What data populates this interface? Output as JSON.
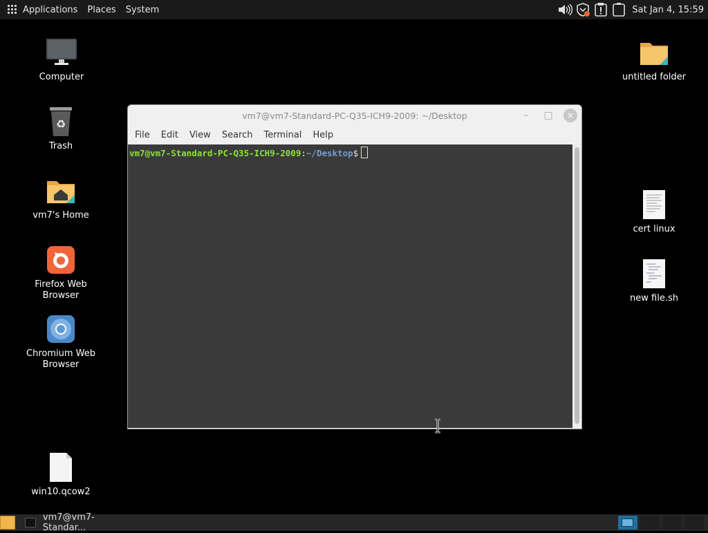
{
  "top_panel": {
    "menus": [
      "Applications",
      "Places",
      "System"
    ],
    "clock": "Sat Jan  4, 15:59",
    "tray_icons": [
      "volume-icon",
      "shield-update-icon",
      "clipboard-alert-icon",
      "battery-icon"
    ]
  },
  "desktop": {
    "icons": [
      {
        "label": "Computer",
        "icon": "monitor-icon"
      },
      {
        "label": "Trash",
        "icon": "trash-icon"
      },
      {
        "label": "vm7's Home",
        "icon": "home-folder-icon"
      },
      {
        "label": "Firefox Web Browser",
        "icon": "firefox-icon"
      },
      {
        "label": "Chromium Web Browser",
        "icon": "chromium-icon"
      },
      {
        "label": "win10.qcow2",
        "icon": "file-icon"
      },
      {
        "label": "untitled folder",
        "icon": "folder-icon"
      },
      {
        "label": "cert linux",
        "icon": "text-document-icon"
      },
      {
        "label": "new file.sh",
        "icon": "script-document-icon"
      }
    ]
  },
  "terminal": {
    "title": "vm7@vm7-Standard-PC-Q35-ICH9-2009: ~/Desktop",
    "menu": [
      "File",
      "Edit",
      "View",
      "Search",
      "Terminal",
      "Help"
    ],
    "prompt_user_host": "vm7@vm7-Standard-PC-Q35-ICH9-2009",
    "prompt_colon": ":",
    "prompt_path": "~/Desktop",
    "prompt_dollar": "$",
    "colors": {
      "user": "#8ae234",
      "path": "#729fcf",
      "background": "#3a3a3a"
    }
  },
  "taskbar": {
    "window_button": "vm7@vm7-Standar...",
    "active_workspace": 1,
    "workspace_count": 4
  }
}
